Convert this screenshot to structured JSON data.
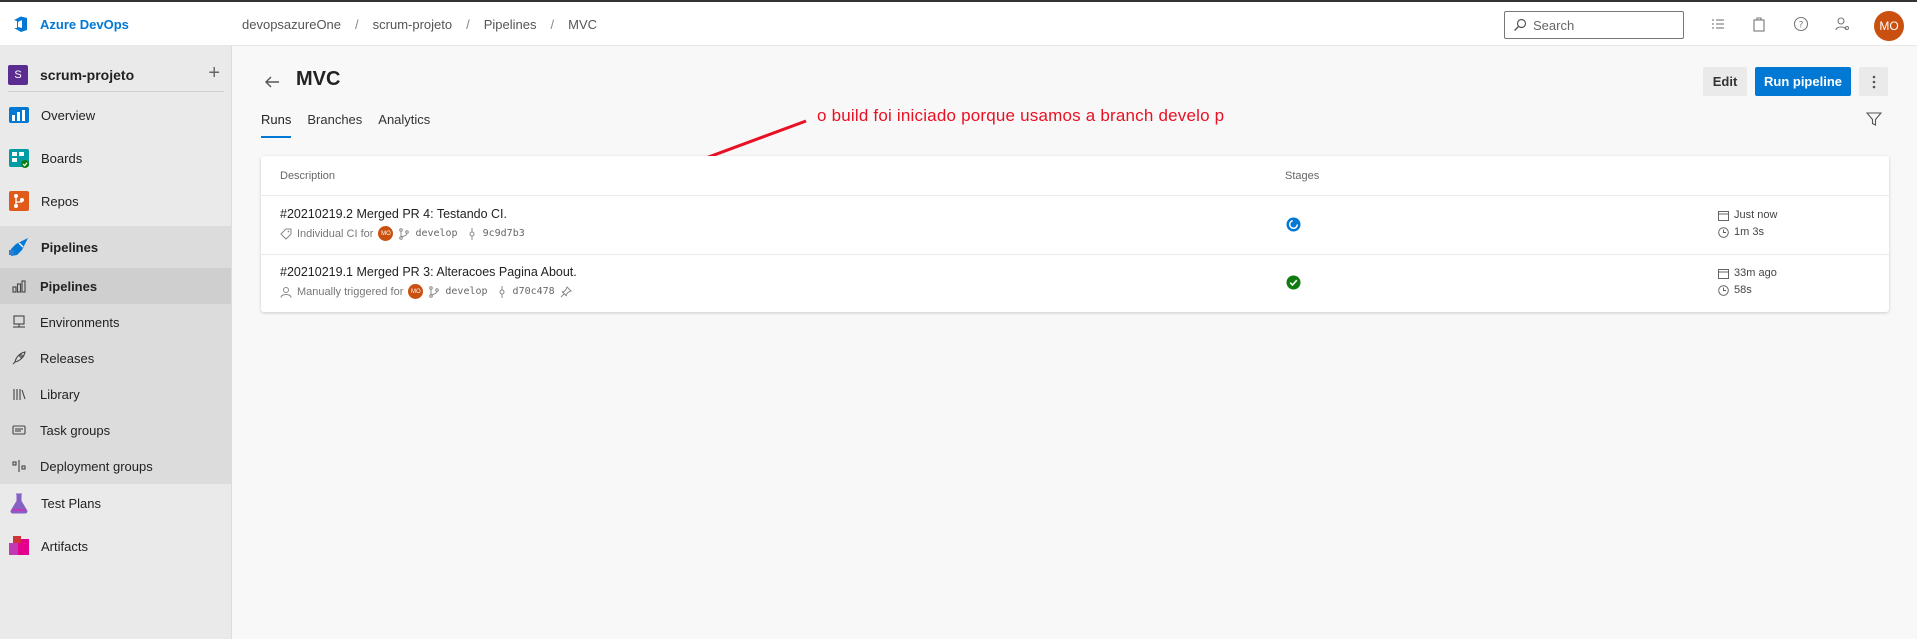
{
  "app": {
    "brand": "Azure DevOps"
  },
  "breadcrumb": [
    "devopsazureOne",
    "scrum-projeto",
    "Pipelines",
    "MVC"
  ],
  "breadcrumb_sep": "/",
  "search": {
    "placeholder": "Search"
  },
  "user": {
    "initials": "MO"
  },
  "sidebar": {
    "project": {
      "badge": "S",
      "name": "scrum-projeto"
    },
    "items": [
      {
        "label": "Overview",
        "icon": "overview-icon"
      },
      {
        "label": "Boards",
        "icon": "boards-icon"
      },
      {
        "label": "Repos",
        "icon": "repos-icon"
      },
      {
        "label": "Pipelines",
        "icon": "pipelines-icon"
      },
      {
        "label": "Test Plans",
        "icon": "test-plans-icon"
      },
      {
        "label": "Artifacts",
        "icon": "artifacts-icon"
      }
    ],
    "pipelines_sub": [
      {
        "label": "Pipelines",
        "icon": "pipelines-sub-icon"
      },
      {
        "label": "Environments",
        "icon": "environments-icon"
      },
      {
        "label": "Releases",
        "icon": "releases-icon"
      },
      {
        "label": "Library",
        "icon": "library-icon"
      },
      {
        "label": "Task groups",
        "icon": "task-groups-icon"
      },
      {
        "label": "Deployment groups",
        "icon": "deployment-groups-icon"
      }
    ]
  },
  "page": {
    "title": "MVC",
    "tabs": [
      "Runs",
      "Branches",
      "Analytics"
    ],
    "active_tab": "Runs",
    "edit_label": "Edit",
    "run_label": "Run pipeline"
  },
  "annotation": "o build foi iniciado porque usamos a branch develo p",
  "table": {
    "col_description": "Description",
    "col_stages": "Stages",
    "runs": [
      {
        "title": "#20210219.2 Merged PR 4: Testando CI.",
        "trigger": "Individual CI for",
        "avatar": "MO",
        "branch": "develop",
        "commit": "9c9d7b3",
        "stage_status": "in-progress",
        "when": "Just now",
        "duration": "1m 3s"
      },
      {
        "title": "#20210219.1 Merged PR 3: Alteracoes Pagina About.",
        "trigger": "Manually triggered for",
        "avatar": "MO",
        "branch": "develop",
        "commit": "d70c478",
        "stage_status": "succeeded",
        "when": "33m ago",
        "duration": "58s"
      }
    ]
  },
  "colors": {
    "accent": "#0078d4",
    "annotation": "#e81123",
    "avatar": "#ca5010",
    "success": "#107c10"
  }
}
